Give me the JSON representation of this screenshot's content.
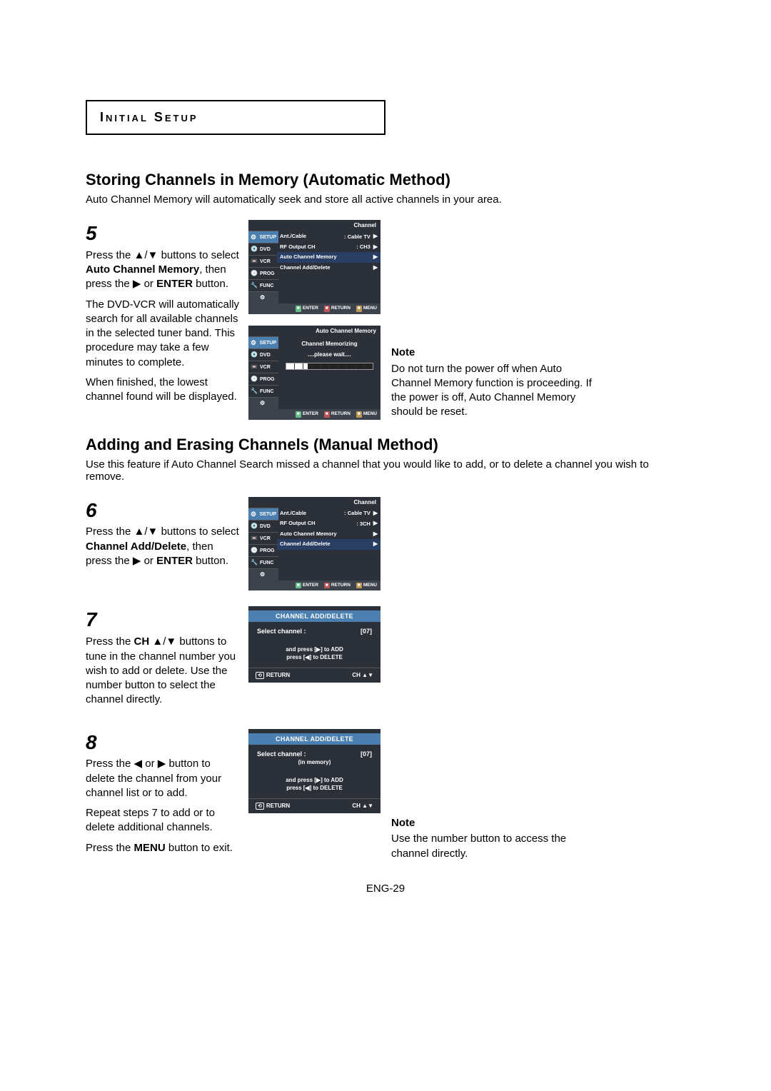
{
  "header": {
    "title": "Initial Setup"
  },
  "section1": {
    "heading": "Storing Channels in Memory (Automatic Method)",
    "intro": "Auto Channel Memory will automatically seek and store all active channels in your area."
  },
  "step5": {
    "num": "5",
    "p1a": "Press the ",
    "p1_arrows": "▲/▼",
    "p1b": " buttons to select ",
    "p1_bold": "Auto Channel Memory",
    "p1c": ", then press the ",
    "p1_play": "▶",
    "p1d": " or ",
    "p1_enter": "ENTER",
    "p1e": " button.",
    "p2": "The DVD-VCR will automatically search for all available channels in the selected tuner band. This procedure may take a few minutes to complete.",
    "p3": "When finished, the lowest channel found will be displayed."
  },
  "note1": {
    "label": "Note",
    "text": "Do not turn the power off when Auto Channel Memory function is proceeding. If the power is off, Auto Channel Memory should be reset."
  },
  "osd1": {
    "title": "Channel",
    "tabs": [
      "SETUP",
      "DVD",
      "VCR",
      "PROG",
      "FUNC",
      ""
    ],
    "rows": [
      {
        "l": "Ant./Cable",
        "v": ": Cable TV"
      },
      {
        "l": "RF Output CH",
        "v": ": CH3"
      },
      {
        "l": "Auto Channel Memory",
        "v": ""
      },
      {
        "l": "Channel Add/Delete",
        "v": ""
      }
    ],
    "foot": [
      "ENTER",
      "RETURN",
      "MENU"
    ]
  },
  "osd2": {
    "title": "Auto Channel Memory",
    "line1": "Channel Memorizing",
    "line2": "....please  wait....",
    "tabs": [
      "SETUP",
      "DVD",
      "VCR",
      "PROG",
      "FUNC",
      ""
    ],
    "foot": [
      "ENTER",
      "RETURN",
      "MENU"
    ]
  },
  "section2": {
    "heading": "Adding and Erasing Channels (Manual Method)",
    "intro": "Use this feature if Auto Channel Search missed a channel that you would like to add, or to delete a channel you wish to remove."
  },
  "step6": {
    "num": "6",
    "p1a": "Press the ",
    "p1_arrows": "▲/▼",
    "p1b": " buttons to select ",
    "p1_bold": "Channel Add/Delete",
    "p1c": ", then press the ",
    "p1_play": "▶",
    "p1d": " or ",
    "p1_enter": "ENTER",
    "p1e": " button."
  },
  "osd3": {
    "title": "Channel",
    "tabs": [
      "SETUP",
      "DVD",
      "VCR",
      "PROG",
      "FUNC",
      ""
    ],
    "rows": [
      {
        "l": "Ant./Cable",
        "v": ": Cable TV"
      },
      {
        "l": "RF Output CH",
        "v": ": 3CH"
      },
      {
        "l": "Auto Channel Memory",
        "v": ""
      },
      {
        "l": "Channel Add/Delete",
        "v": ""
      }
    ],
    "foot": [
      "ENTER",
      "RETURN",
      "MENU"
    ]
  },
  "step7": {
    "num": "7",
    "p1a": "Press the ",
    "p1_bold1": "CH ",
    "p1_arrows": "▲/▼",
    "p1b": " buttons to tune in the channel number you wish to add or delete. Use the number button to select the channel directly."
  },
  "osd4": {
    "heading": "CHANNEL ADD/DELETE",
    "sel_label": "Select channel :",
    "sel_val": "[07]",
    "instr1": "and press [▶] to ADD",
    "instr2": "press [◀] to DELETE",
    "ret": "RETURN",
    "ch": "CH ▲▼"
  },
  "step8": {
    "num": "8",
    "p1a": "Press the ",
    "p1_l": "◀",
    "p1_or": " or ",
    "p1_r": "▶",
    "p1b": " button to delete the channel from your channel list or to add.",
    "p2": "Repeat steps 7 to add or to delete additional channels.",
    "p3a": "Press the ",
    "p3_bold": "MENU",
    "p3b": " button to exit."
  },
  "osd5": {
    "heading": "CHANNEL ADD/DELETE",
    "sel_label": "Select channel :",
    "sel_val": "[07]",
    "sub": "(in memory)",
    "instr1": "and press [▶] to ADD",
    "instr2": "press [◀] to DELETE",
    "ret": "RETURN",
    "ch": "CH ▲▼"
  },
  "note2": {
    "label": "Note",
    "text": "Use the number button to access the channel directly."
  },
  "pagenum": "ENG-29"
}
